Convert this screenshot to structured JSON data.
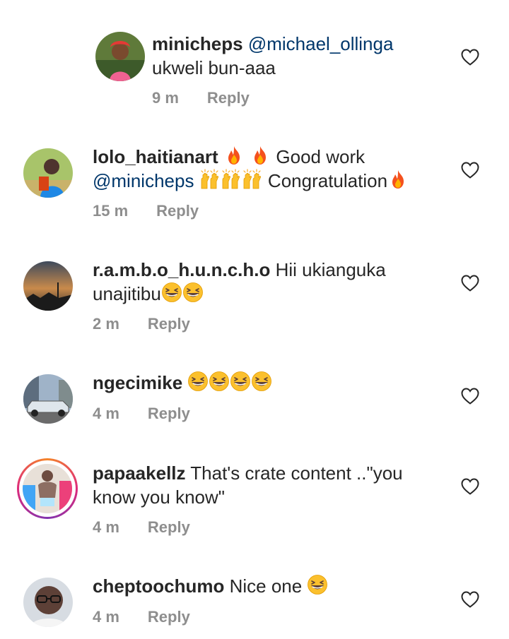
{
  "comments": [
    {
      "username": "minicheps",
      "mention": "@michael_ollinga",
      "text_line1": "ukweli bun-aaa",
      "time": "9 m",
      "reply_label": "Reply"
    },
    {
      "username": "lolo_haitianart",
      "text_part1": "Good work",
      "mention": "@minicheps",
      "text_part2": "Congratulation",
      "time": "15 m",
      "reply_label": "Reply",
      "emojis": [
        "fire",
        "fire",
        "raising-hands",
        "raising-hands",
        "raising-hands",
        "fire"
      ]
    },
    {
      "username": "r.a.m.b.o_h.u.n.c.h.o",
      "text_part1": "Hii ukianguka",
      "text_part2": "unajitibu",
      "time": "2 m",
      "reply_label": "Reply",
      "emojis": [
        "grinning-squinting",
        "grinning-squinting"
      ]
    },
    {
      "username": "ngecimike",
      "time": "4 m",
      "reply_label": "Reply",
      "emojis": [
        "grinning-squinting",
        "grinning-squinting",
        "grinning-squinting",
        "grinning-squinting"
      ]
    },
    {
      "username": "papaakellz",
      "text_part1": "That's crate content ..\"you",
      "text_part2": "know you know\"",
      "time": "4 m",
      "reply_label": "Reply"
    },
    {
      "username": "cheptoochumo",
      "text_part1": "Nice one",
      "time": "4 m",
      "reply_label": "Reply",
      "emojis": [
        "grinning-squinting"
      ]
    }
  ],
  "icons": {
    "like": "heart-outline-icon"
  },
  "colors": {
    "mention": "#00376b",
    "meta": "#8e8e8e",
    "text": "#262626"
  }
}
